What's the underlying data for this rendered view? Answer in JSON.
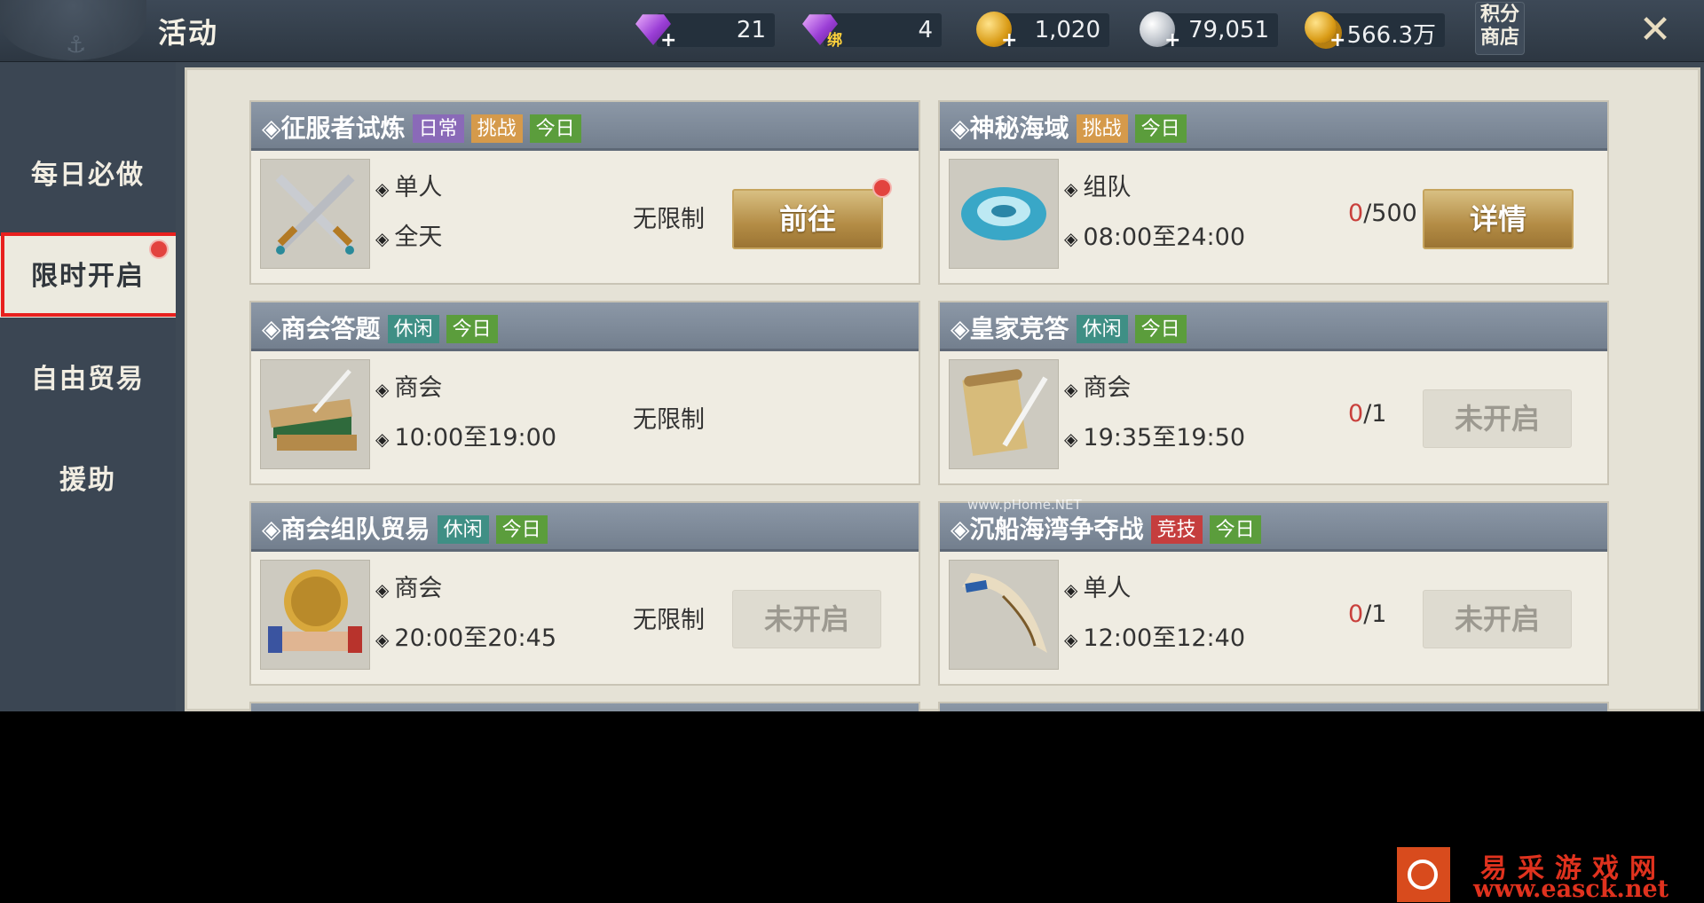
{
  "header": {
    "title": "活动",
    "currencies": [
      {
        "icon": "purple-diamond-icon",
        "value": "21"
      },
      {
        "icon": "bound-diamond-icon",
        "badge": "绑",
        "value": "4"
      },
      {
        "icon": "gold-coin-icon",
        "value": "1,020"
      },
      {
        "icon": "silver-coin-icon",
        "value": "79,051"
      },
      {
        "icon": "gold-coin-stack-icon",
        "value": "566.3万"
      }
    ],
    "points_shop_line1": "积分",
    "points_shop_line2": "商店",
    "close_icon": "close-x-icon"
  },
  "sidebar": {
    "items": [
      {
        "label": "每日必做"
      },
      {
        "label": "限时开启",
        "active": true,
        "notification": true
      },
      {
        "label": "自由贸易"
      },
      {
        "label": "援助"
      }
    ]
  },
  "activities": [
    {
      "name": "征服者试炼",
      "tags": [
        "日常",
        "挑战",
        "今日"
      ],
      "icon": "crossed-swords-icon",
      "mode": "单人",
      "time": "全天",
      "limit": "无限制",
      "button": "前往",
      "button_state": "active",
      "notification": true
    },
    {
      "name": "神秘海域",
      "tags": [
        "挑战",
        "今日"
      ],
      "icon": "blue-vortex-icon",
      "mode": "组队",
      "time": "08:00至24:00",
      "count_done": "0",
      "count_total": "/500",
      "button": "详情",
      "button_state": "active"
    },
    {
      "name": "商会答题",
      "tags": [
        "休闲",
        "今日"
      ],
      "icon": "books-quill-icon",
      "mode": "商会",
      "time": "10:00至19:00",
      "limit": "无限制"
    },
    {
      "name": "皇家竞答",
      "tags": [
        "休闲",
        "今日"
      ],
      "icon": "scroll-quill-icon",
      "mode": "商会",
      "time": "19:35至19:50",
      "count_done": "0",
      "count_total": "/1",
      "button": "未开启",
      "button_state": "disabled"
    },
    {
      "name": "商会组队贸易",
      "tags": [
        "休闲",
        "今日"
      ],
      "icon": "handshake-coin-icon",
      "mode": "商会",
      "time": "20:00至20:45",
      "limit": "无限制",
      "button": "未开启",
      "button_state": "disabled"
    },
    {
      "name": "沉船海湾争夺战",
      "tags": [
        "竞技",
        "今日"
      ],
      "icon": "war-horn-icon",
      "mode": "单人",
      "time": "12:00至12:40",
      "count_done": "0",
      "count_total": "/1",
      "button": "未开启",
      "button_state": "disabled"
    }
  ],
  "tag_colors": {
    "日常": "#8a6ab8",
    "挑战": "#d59a4b",
    "今日": "#5b9d3c",
    "休闲": "#3f8f85",
    "竞技": "#c53e3e"
  },
  "watermark": {
    "site_name": "易采游戏网",
    "url": "www.easck.net",
    "small": "www.pHome.NET"
  }
}
